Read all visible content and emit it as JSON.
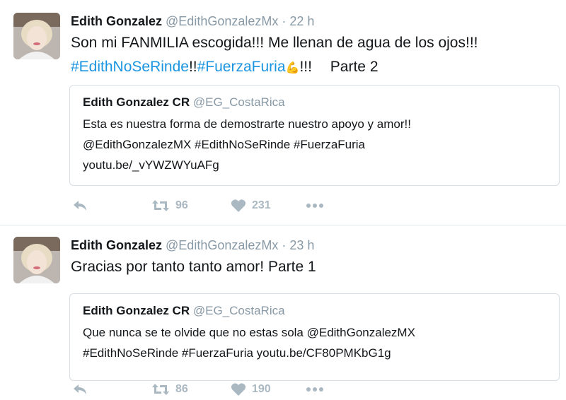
{
  "tweets": [
    {
      "author": {
        "name": "Edith Gonzalez",
        "handle": "@EdithGonzalezMx",
        "time": "· 22 h"
      },
      "text": {
        "line1": "Son mi FANMILIA escogida!!! Me llenan de agua de los ojos!!!",
        "hashtag1": "#EdithNoSeRinde",
        "mid": "!!",
        "hashtag2": "#FuerzaFuria",
        "emoji": "💪",
        "tail": "!!!",
        "part": "Parte 2"
      },
      "quote": {
        "name": "Edith Gonzalez CR",
        "handle": "@EG_CostaRica",
        "lines": [
          "Esta es nuestra forma de demostrarte nuestro apoyo y amor!!",
          "@EdithGonzalezMX #EdithNoSeRinde #FuerzaFuria",
          "youtu.be/_vYWZWYuAFg"
        ]
      },
      "retweets": "96",
      "likes": "231"
    },
    {
      "author": {
        "name": "Edith Gonzalez",
        "handle": "@EdithGonzalezMx",
        "time": "· 23 h"
      },
      "text": {
        "line1": "Gracias por tanto tanto amor! Parte 1"
      },
      "quote": {
        "name": "Edith Gonzalez CR",
        "handle": "@EG_CostaRica",
        "lines": [
          "Que nunca se te olvide que no estas sola @EdithGonzalezMX",
          "#EdithNoSeRinde #FuerzaFuria youtu.be/CF80PMKbG1g"
        ]
      },
      "retweets": "86",
      "likes": "190"
    }
  ],
  "icons": {
    "reply": "reply-icon",
    "retweet": "retweet-icon",
    "like": "heart-icon",
    "more": "more-icon"
  },
  "colors": {
    "hashtag": "#1b95e0",
    "muted": "#8899a6",
    "action": "#aab8c2",
    "border": "#e1e8ed"
  }
}
